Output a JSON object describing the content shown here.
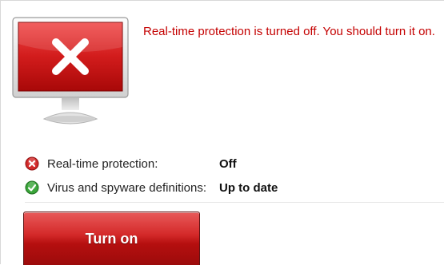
{
  "alert": {
    "message": "Real-time protection is turned off. You should turn it on."
  },
  "status": [
    {
      "icon": "error-icon",
      "label": "Real-time protection:",
      "value": "Off"
    },
    {
      "icon": "check-icon",
      "label": "Virus and spyware definitions:",
      "value": "Up to date"
    }
  ],
  "actions": {
    "turn_on_label": "Turn on"
  },
  "colors": {
    "alert_red": "#c40000",
    "button_red": "#b50f0f",
    "ok_green": "#2f9e2f"
  }
}
